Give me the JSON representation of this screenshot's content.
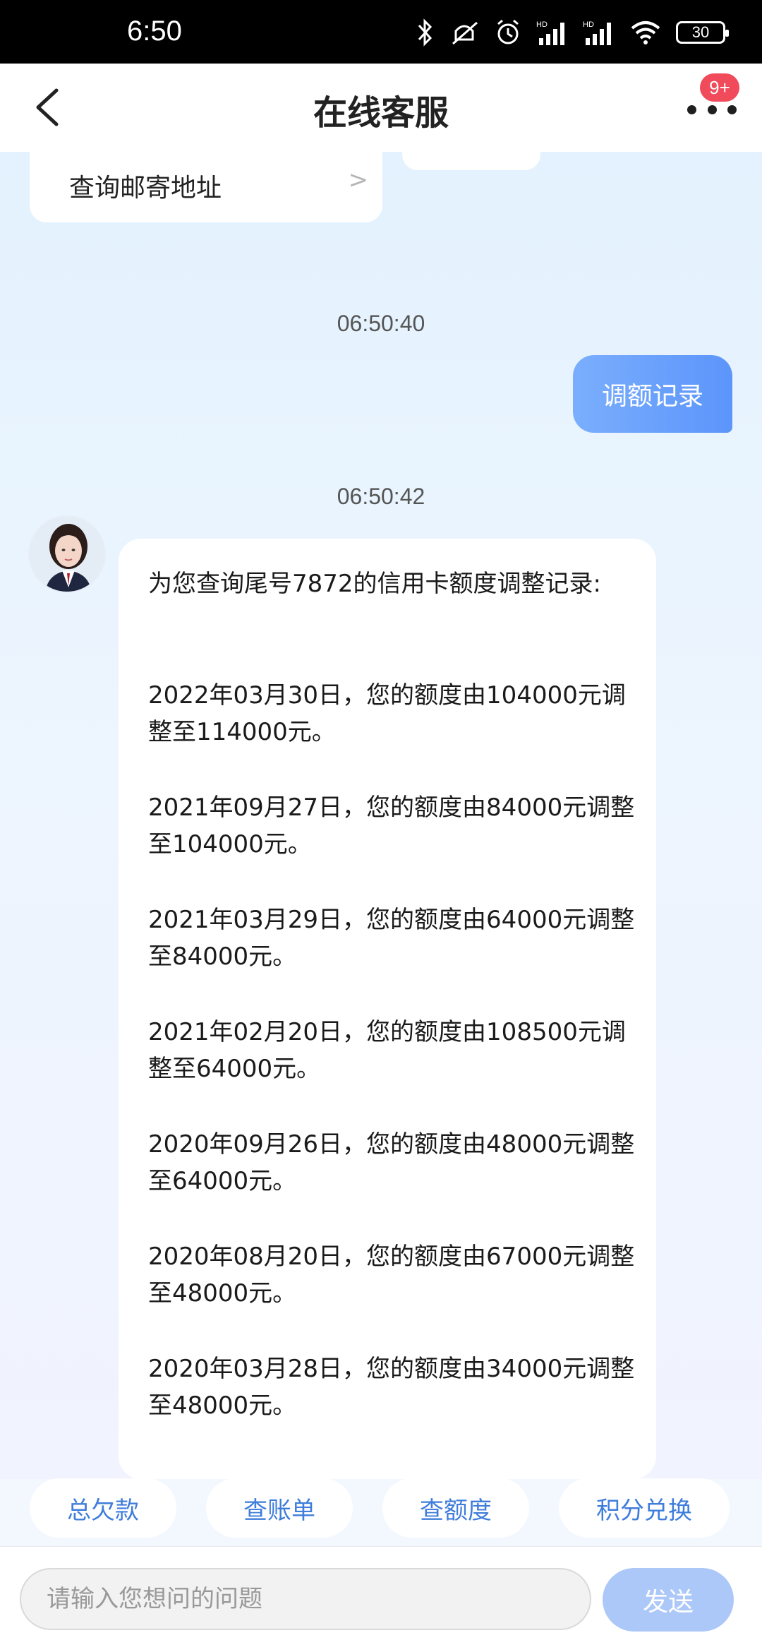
{
  "status_bar": {
    "time": "6:50",
    "battery": "30",
    "icons": [
      "bluetooth-icon",
      "mute-icon",
      "alarm-icon",
      "signal-hd-icon",
      "signal-hd-icon",
      "wifi-icon",
      "battery-icon"
    ]
  },
  "header": {
    "title": "在线客服",
    "badge": "9+"
  },
  "chat": {
    "previous_card_label": "查询邮寄地址",
    "previous_card_chevron": ">",
    "timestamp_1": "06:50:40",
    "user_message": "调额记录",
    "timestamp_2": "06:50:42",
    "bot_intro": "为您查询尾号7872的信用卡额度调整记录:",
    "records": [
      "2022年03月30日，您的额度由104000元调整至114000元。",
      "2021年09月27日，您的额度由84000元调整至104000元。",
      "2021年03月29日，您的额度由64000元调整至84000元。",
      "2021年02月20日，您的额度由108500元调整至64000元。",
      "2020年09月26日，您的额度由48000元调整至64000元。",
      "2020年08月20日，您的额度由67000元调整至48000元。",
      "2020年03月28日，您的额度由34000元调整至48000元。"
    ]
  },
  "quick_actions": [
    "总欠款",
    "查账单",
    "查额度",
    "积分兑换"
  ],
  "input": {
    "placeholder": "请输入您想问的问题",
    "send_label": "发送"
  },
  "colors": {
    "accent": "#5c95fb",
    "quick_text": "#3f7ddb",
    "badge": "#f04a5b",
    "send_disabled": "#acc8f8"
  }
}
